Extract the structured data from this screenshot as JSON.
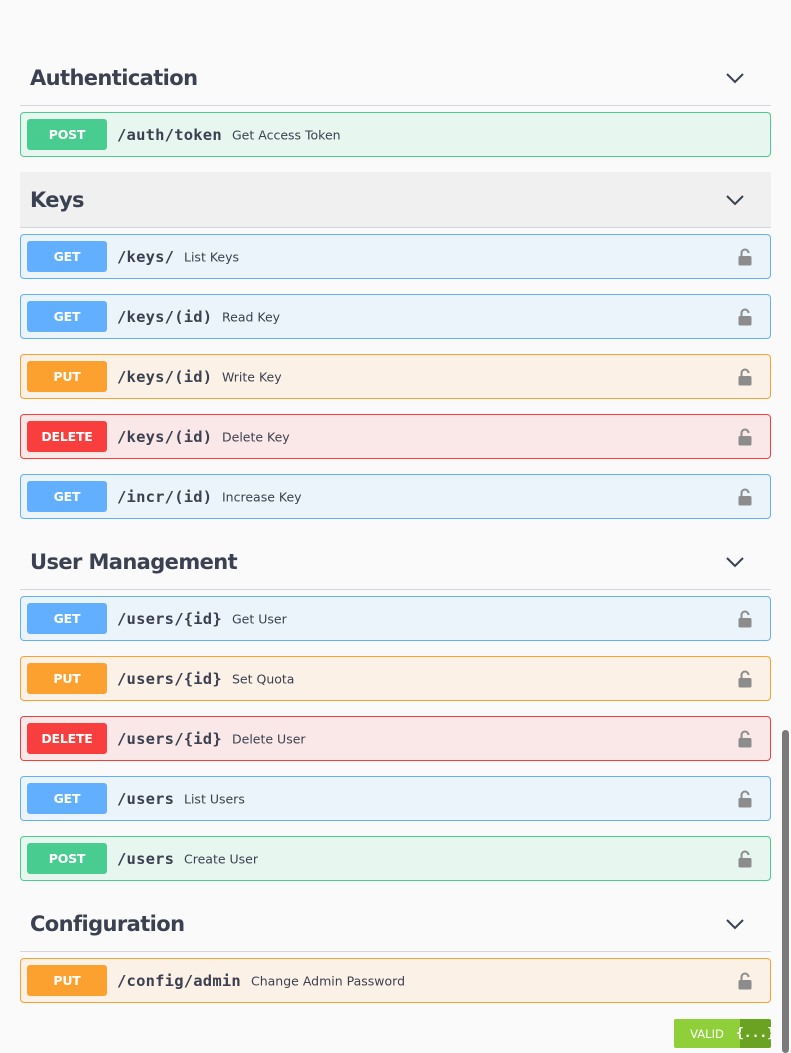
{
  "sections": [
    {
      "title": "Authentication",
      "operations": [
        {
          "method": "POST",
          "path": "/auth/token",
          "summary": "Get Access Token",
          "locked": false
        }
      ]
    },
    {
      "title": "Keys",
      "operations": [
        {
          "method": "GET",
          "path": "/keys/",
          "summary": "List Keys",
          "locked": true
        },
        {
          "method": "GET",
          "path": "/keys/(id)",
          "summary": "Read Key",
          "locked": true
        },
        {
          "method": "PUT",
          "path": "/keys/(id)",
          "summary": "Write Key",
          "locked": true
        },
        {
          "method": "DELETE",
          "path": "/keys/(id)",
          "summary": "Delete Key",
          "locked": true
        },
        {
          "method": "GET",
          "path": "/incr/(id)",
          "summary": "Increase Key",
          "locked": true
        }
      ]
    },
    {
      "title": "User Management",
      "operations": [
        {
          "method": "GET",
          "path": "/users/{id}",
          "summary": "Get User",
          "locked": true
        },
        {
          "method": "PUT",
          "path": "/users/{id}",
          "summary": "Set Quota",
          "locked": true
        },
        {
          "method": "DELETE",
          "path": "/users/{id}",
          "summary": "Delete User",
          "locked": true
        },
        {
          "method": "GET",
          "path": "/users",
          "summary": "List Users",
          "locked": true
        },
        {
          "method": "POST",
          "path": "/users",
          "summary": "Create User",
          "locked": true
        }
      ]
    },
    {
      "title": "Configuration",
      "operations": [
        {
          "method": "PUT",
          "path": "/config/admin",
          "summary": "Change Admin Password",
          "locked": true
        }
      ]
    }
  ],
  "validator": {
    "label": "VALID",
    "icon_text": "{...}"
  },
  "colors": {
    "post": "#49cc90",
    "get": "#61affe",
    "put": "#fca130",
    "delete": "#f93e3e",
    "valid": "#8ecf3a"
  },
  "icons": {
    "collapse": "chevron-down-icon",
    "auth": "lock-icon"
  }
}
